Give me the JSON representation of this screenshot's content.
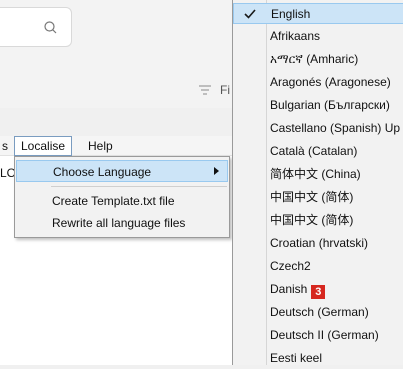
{
  "menubar": {
    "items": [
      {
        "label": "s"
      },
      {
        "label": "Localise"
      },
      {
        "label": "Help"
      }
    ]
  },
  "toolbar": {
    "filter_label": "Fi"
  },
  "left_cut_text": "LO",
  "localise_menu": {
    "items": [
      {
        "label": "Choose Language"
      },
      {
        "label": "Create Template.txt file"
      },
      {
        "label": "Rewrite all language files"
      }
    ]
  },
  "languages": [
    {
      "label": "English",
      "checked": true
    },
    {
      "label": "Afrikaans"
    },
    {
      "label": "አማርኛ (Amharic)"
    },
    {
      "label": "Aragonés (Aragonese)"
    },
    {
      "label": "Bulgarian (Български)"
    },
    {
      "label": "Castellano (Spanish) Up"
    },
    {
      "label": "Català (Catalan)"
    },
    {
      "label": "简体中文 (China)"
    },
    {
      "label": "中国中文 (简体)"
    },
    {
      "label": "中国中文 (简体)"
    },
    {
      "label": "Croatian (hrvatski)"
    },
    {
      "label": "Czech2"
    },
    {
      "label": "Danish",
      "badge": "3"
    },
    {
      "label": "Deutsch (German)"
    },
    {
      "label": "Deutsch II (German)"
    },
    {
      "label": "Eesti keel"
    }
  ],
  "colors": {
    "highlight": "#cce4f7",
    "badge": "#d6271f"
  }
}
